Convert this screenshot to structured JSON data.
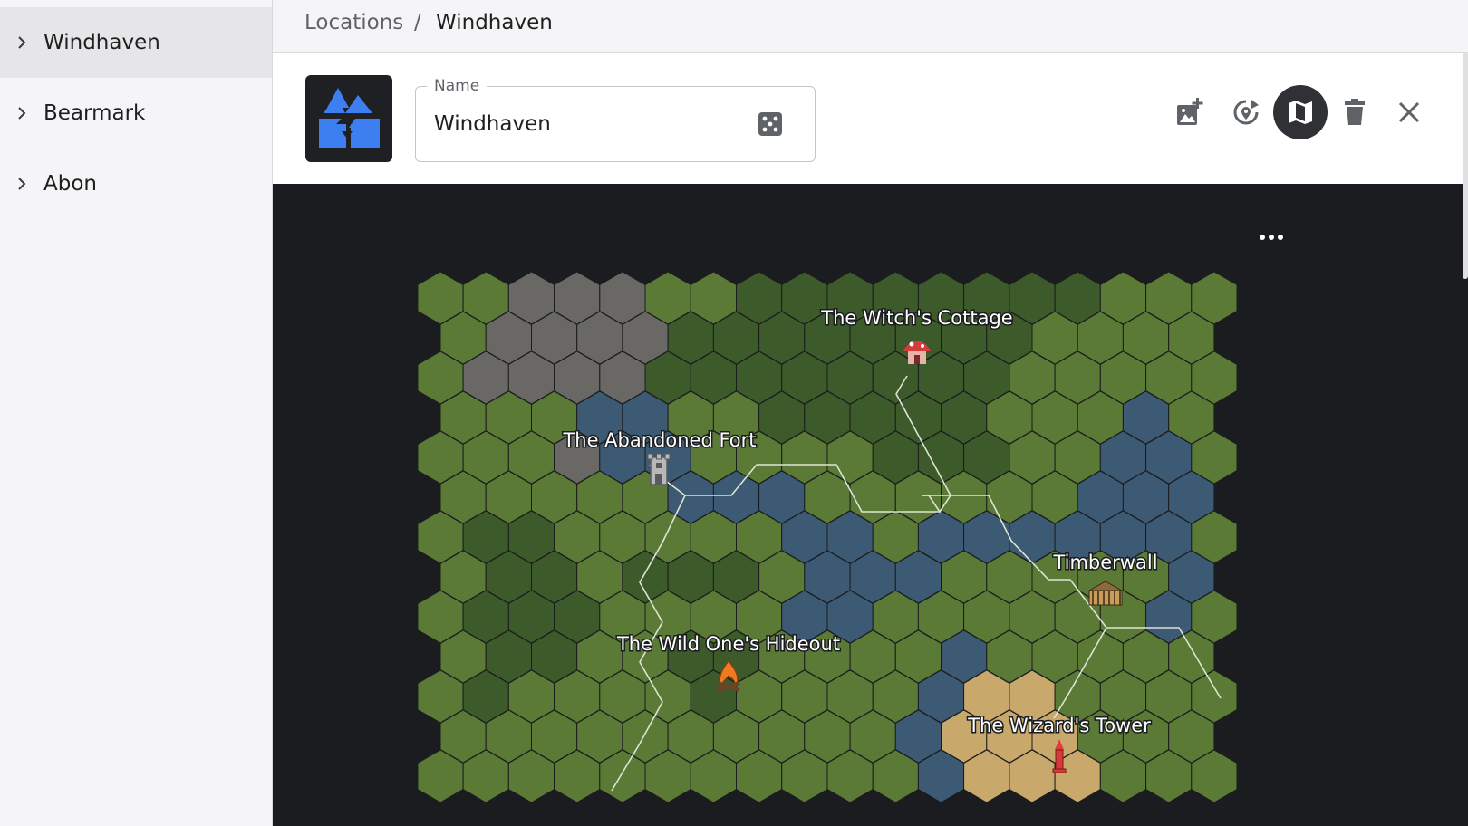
{
  "sidebar": {
    "items": [
      {
        "label": "Windhaven",
        "active": true
      },
      {
        "label": "Bearmark",
        "active": false
      },
      {
        "label": "Abon",
        "active": false
      }
    ]
  },
  "breadcrumb": {
    "root": "Locations",
    "separator": "/",
    "current": "Windhaven"
  },
  "header": {
    "name_legend": "Name",
    "name_value": "Windhaven",
    "icon": "mountains-castle-icon",
    "actions": [
      {
        "name": "add-image-icon"
      },
      {
        "name": "rotate-pin-icon"
      },
      {
        "name": "map-icon",
        "selected": true
      },
      {
        "name": "trash-icon"
      },
      {
        "name": "close-icon"
      }
    ]
  },
  "map": {
    "more_icon": "more-horizontal-icon",
    "colors": {
      "grass": "#5a7a36",
      "forest": "#3d5a2a",
      "mountain": "#696864",
      "water": "#3c5a73",
      "sand": "#c9a86b",
      "background": "#1b1c1f"
    },
    "locations": [
      {
        "name": "The Witch's Cottage",
        "icon": "mushroom-house-icon"
      },
      {
        "name": "The Abandoned Fort",
        "icon": "tower-icon"
      },
      {
        "name": "Timberwall",
        "icon": "palisade-icon"
      },
      {
        "name": "The Wild One's Hideout",
        "icon": "campfire-icon"
      },
      {
        "name": "The Wizard's Tower",
        "icon": "wizard-tower-icon"
      }
    ]
  }
}
